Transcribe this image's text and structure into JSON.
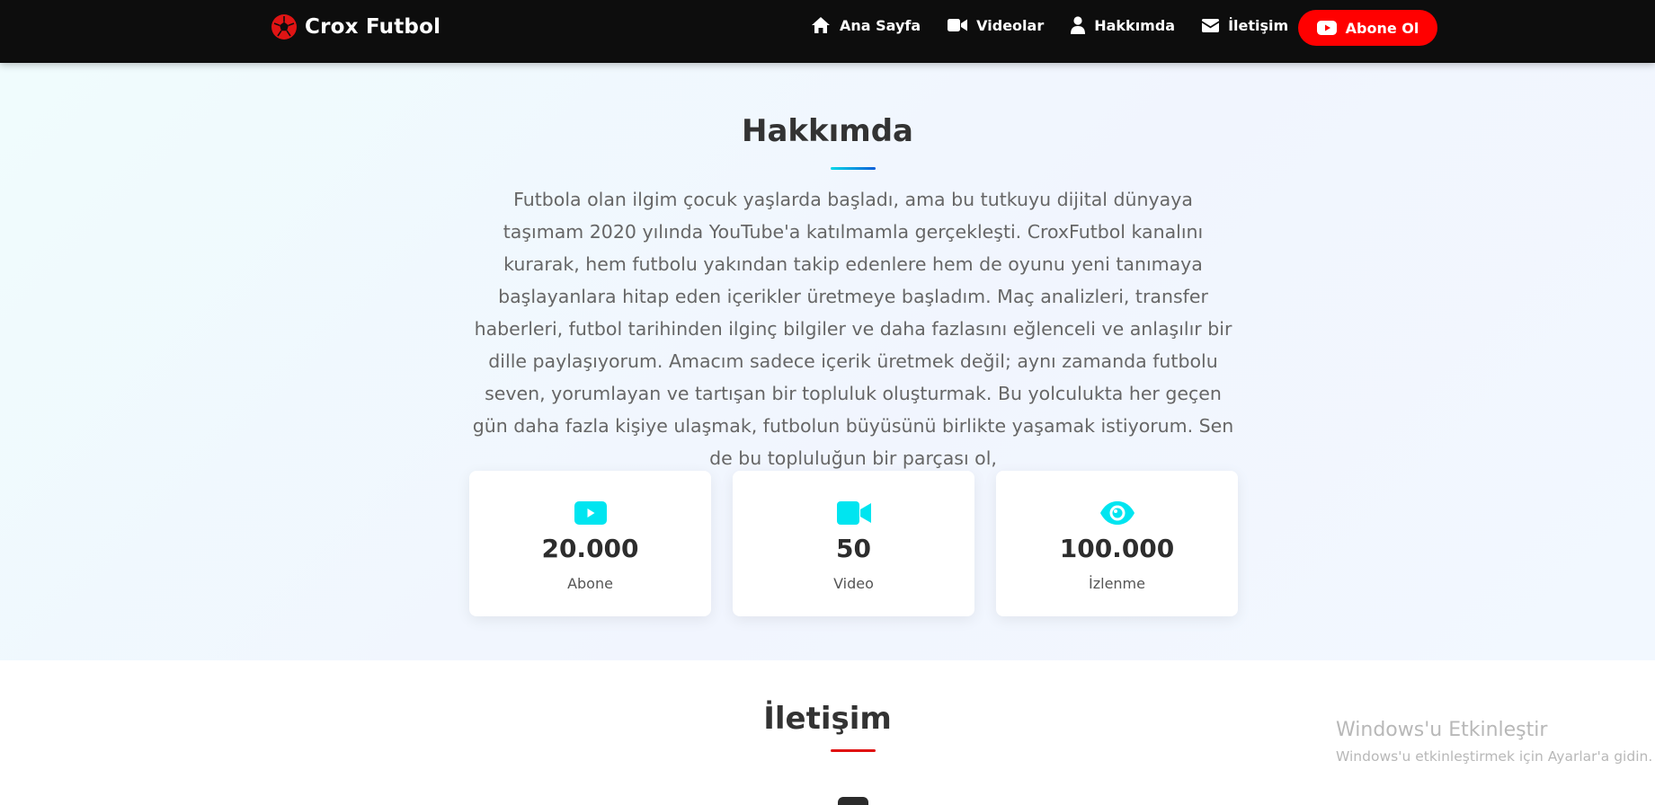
{
  "navbar": {
    "brand": {
      "name": "Crox Futbol",
      "icon": "futbol-icon"
    },
    "links": [
      {
        "label": "Ana Sayfa",
        "icon": "home-icon"
      },
      {
        "label": "Videolar",
        "icon": "video-camera-icon"
      },
      {
        "label": "Hakkımda",
        "icon": "user-icon"
      },
      {
        "label": "İletişim",
        "icon": "envelope-icon"
      }
    ],
    "subscribe": {
      "label": "Abone Ol",
      "icon": "youtube-icon"
    }
  },
  "about": {
    "title": "Hakkımda",
    "text": "Futbola olan ilgim çocuk yaşlarda başladı, ama bu tutkuyu dijital dünyaya taşımam 2020 yılında YouTube'a katılmamla gerçekleşti. CroxFutbol kanalını kurarak, hem futbolu yakından takip edenlere hem de oyunu yeni tanımaya başlayanlara hitap eden içerikler üretmeye başladım. Maç analizleri, transfer haberleri, futbol tarihinden ilginç bilgiler ve daha fazlasını eğlenceli ve anlaşılır bir dille paylaşıyorum. Amacım sadece içerik üretmek değil; aynı zamanda futbolu seven, yorumlayan ve tartışan bir topluluk oluşturmak. Bu yolculukta her geçen gün daha fazla kişiye ulaşmak, futbolun büyüsünü birlikte yaşamak istiyorum. Sen de bu topluluğun bir parçası ol,",
    "stats": [
      {
        "value": "20.000",
        "label": "Abone",
        "icon": "youtube-icon"
      },
      {
        "value": "50",
        "label": "Video",
        "icon": "video-camera-icon"
      },
      {
        "value": "100.000",
        "label": "İzlenme",
        "icon": "eye-icon"
      }
    ]
  },
  "contact": {
    "title": "İletişim"
  },
  "watermark": {
    "title": "Windows'u Etkinleştir",
    "subtitle": "Windows'u etkinleştirmek için Ayarlar'a gidin."
  },
  "colors": {
    "navbar_bg": "#0d0d0d",
    "accent_red": "#ff0000",
    "accent_cyan": "#00e5f0",
    "about_bg": "#f0f8fe"
  }
}
